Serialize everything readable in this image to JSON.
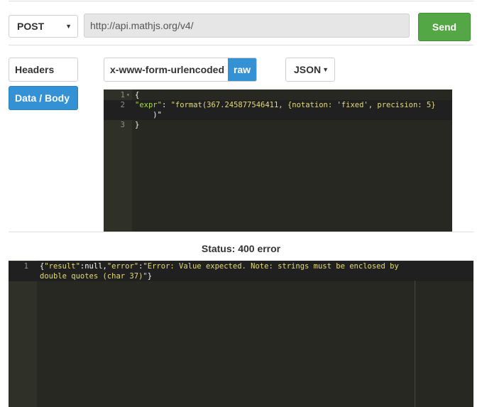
{
  "request": {
    "method": "POST",
    "url": "http://api.mathjs.org/v4/",
    "send_label": "Send"
  },
  "tabs": [
    {
      "label": "Headers",
      "active": false
    },
    {
      "label": "Data / Body",
      "active": true
    }
  ],
  "body_type": {
    "encoding_label": "x-www-form-urlencoded",
    "raw_label": "raw",
    "format": "JSON"
  },
  "editor": {
    "lines": [
      {
        "num": "1",
        "text": "{"
      },
      {
        "num": "2",
        "key": "\"expr\"",
        "sep": ": ",
        "value": "\"format(367.245877546411, {notation: 'fixed', precision: 5}",
        "value_wrap": "    )\""
      },
      {
        "num": "3",
        "text": "}"
      }
    ]
  },
  "status": {
    "text": "Status: 400 error"
  },
  "response": {
    "line_num": "1",
    "open": "{",
    "k1": "\"result\"",
    "c1": ":null,",
    "k2": "\"error\"",
    "c2": ":",
    "v2": "\"Error: Value expected. Note: strings must be enclosed by double quotes (char 37)\"",
    "close": "}"
  }
}
